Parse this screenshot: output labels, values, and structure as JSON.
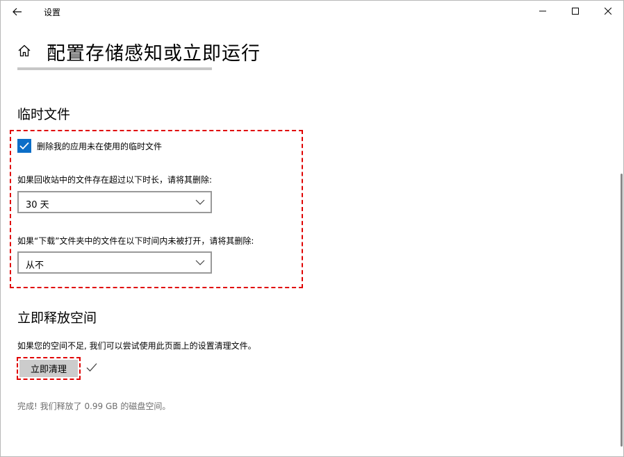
{
  "titlebar": {
    "back_icon": "back-arrow-icon",
    "title": "设置",
    "minimize_icon": "minimize-icon",
    "maximize_icon": "maximize-icon",
    "close_icon": "close-icon"
  },
  "header": {
    "home_icon": "home-icon",
    "title": "配置存储感知或立即运行"
  },
  "temp_files": {
    "heading": "临时文件",
    "checkbox": {
      "label": "删除我的应用未在使用的临时文件",
      "checked": true
    },
    "recycle_bin": {
      "label": "如果回收站中的文件存在超过以下时长，请将其删除:",
      "value": "30 天"
    },
    "downloads": {
      "label": "如果“下载”文件夹中的文件在以下时间内未被打开，请将其删除:",
      "value": "从不"
    }
  },
  "free_space": {
    "heading": "立即释放空间",
    "description": "如果您的空间不足, 我们可以尝试使用此页面上的设置清理文件。",
    "button_label": "立即清理",
    "done_icon": "checkmark-icon",
    "status": "完成! 我们释放了 0.99 GB 的磁盘空间。"
  },
  "colors": {
    "accent": "#0b6ec8",
    "highlight": "#e00000",
    "button_bg": "#cccccc",
    "status_text": "#6d6d6d"
  }
}
